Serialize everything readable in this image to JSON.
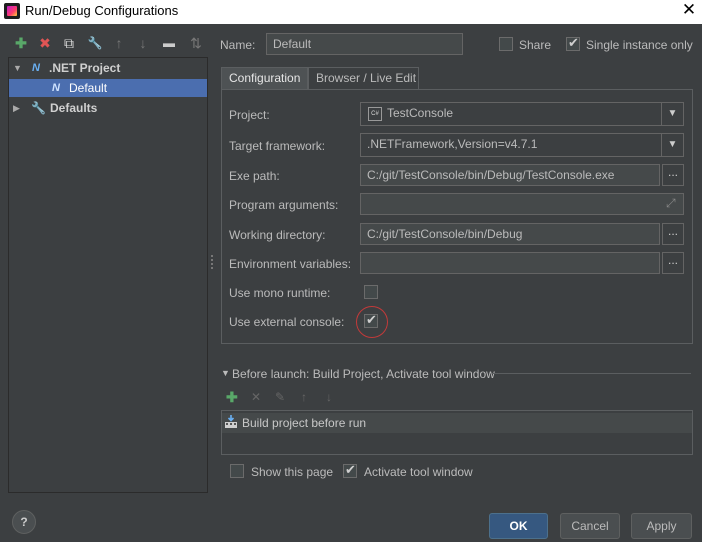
{
  "window": {
    "title": "Run/Debug Configurations",
    "close_glyph": "✕"
  },
  "tree_toolbar": {
    "add": "✚",
    "remove": "✖",
    "copy": "⧉",
    "edit_defaults": "🔧",
    "move_up": "↑",
    "move_down": "↓",
    "folder": "▬",
    "sort": "⇅"
  },
  "tree": {
    "group_label": ".NET Project",
    "group_icon": "N",
    "child_label": "Default",
    "child_icon": "N",
    "defaults_label": "Defaults"
  },
  "name_row": {
    "label": "Name:",
    "value": "Default",
    "share_label": "Share",
    "share_checked": false,
    "single_instance_label": "Single instance only",
    "single_instance_checked": true
  },
  "tabs": [
    "Configuration",
    "Browser / Live Edit"
  ],
  "config": {
    "project_label": "Project:",
    "project_value": "TestConsole",
    "project_icon": "C#",
    "target_label": "Target framework:",
    "target_value": ".NETFramework,Version=v4.7.1",
    "exe_label": "Exe path:",
    "exe_value": "C:/git/TestConsole/bin/Debug/TestConsole.exe",
    "args_label": "Program arguments:",
    "args_value": "",
    "workdir_label": "Working directory:",
    "workdir_value": "C:/git/TestConsole/bin/Debug",
    "env_label": "Environment variables:",
    "env_value": "",
    "mono_label": "Use mono runtime:",
    "mono_checked": false,
    "external_console_label": "Use external console:",
    "external_console_checked": true,
    "browse_glyph": "...",
    "expand_glyph": "⤢",
    "dropdown_glyph": "▼"
  },
  "before_launch": {
    "header": "Before launch: Build Project, Activate tool window",
    "toolbar": [
      "✚",
      "✕",
      "✎",
      "↑",
      "↓"
    ],
    "item": "Build project before run",
    "show_page_label": "Show this page",
    "show_page_checked": false,
    "activate_label": "Activate tool window",
    "activate_checked": true
  },
  "buttons": {
    "help": "?",
    "ok": "OK",
    "cancel": "Cancel",
    "apply": "Apply"
  },
  "colors": {
    "background": "#3c3f41",
    "selection": "#4b6eaf",
    "primary_button": "#365880",
    "add_green": "#59a869",
    "remove_red": "#e05555",
    "highlight_circle": "#c23a3a"
  }
}
